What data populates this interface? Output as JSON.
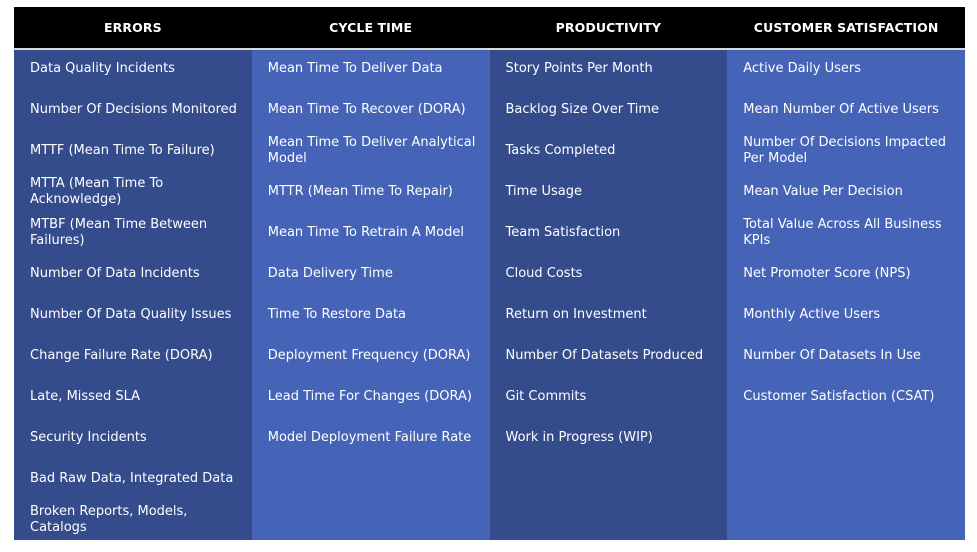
{
  "columns": [
    {
      "title": "ERRORS",
      "items": [
        "Data Quality Incidents",
        "Number Of Decisions Monitored",
        "MTTF (Mean Time To Failure)",
        "MTTA (Mean Time To Acknowledge)",
        "MTBF (Mean Time Between Failures)",
        "Number Of Data Incidents",
        "Number Of Data Quality Issues",
        "Change Failure Rate (DORA)",
        "Late, Missed SLA",
        "Security Incidents",
        "Bad Raw Data, Integrated Data",
        "Broken Reports, Models, Catalogs"
      ]
    },
    {
      "title": "CYCLE TIME",
      "items": [
        "Mean Time To Deliver Data",
        "Mean Time To Recover (DORA)",
        "Mean Time To Deliver Analytical Model",
        "MTTR (Mean Time To Repair)",
        "Mean Time To Retrain A Model",
        "Data Delivery Time",
        "Time To Restore Data",
        "Deployment Frequency (DORA)",
        "Lead Time For Changes (DORA)",
        "Model Deployment Failure Rate"
      ]
    },
    {
      "title": "PRODUCTIVITY",
      "items": [
        "Story Points Per Month",
        "Backlog Size Over Time",
        "Tasks Completed",
        "Time Usage",
        "Team Satisfaction",
        "Cloud Costs",
        "Return on Investment",
        "Number Of Datasets Produced",
        "Git Commits",
        "Work in Progress (WIP)"
      ]
    },
    {
      "title": "CUSTOMER SATISFACTION",
      "items": [
        "Active Daily Users",
        "Mean Number Of Active Users",
        "Number Of Decisions Impacted Per Model",
        "Mean Value Per Decision",
        "Total Value Across All Business KPIs",
        "Net Promoter Score (NPS)",
        "Monthly Active Users",
        "Number Of Datasets In Use",
        "Customer Satisfaction (CSAT)"
      ]
    }
  ],
  "colors": {
    "header_bg": "#000000",
    "header_text": "#ffffff",
    "column_dark": "#344b8c",
    "column_light": "#4563b7",
    "separator": "#d8d8d8"
  }
}
